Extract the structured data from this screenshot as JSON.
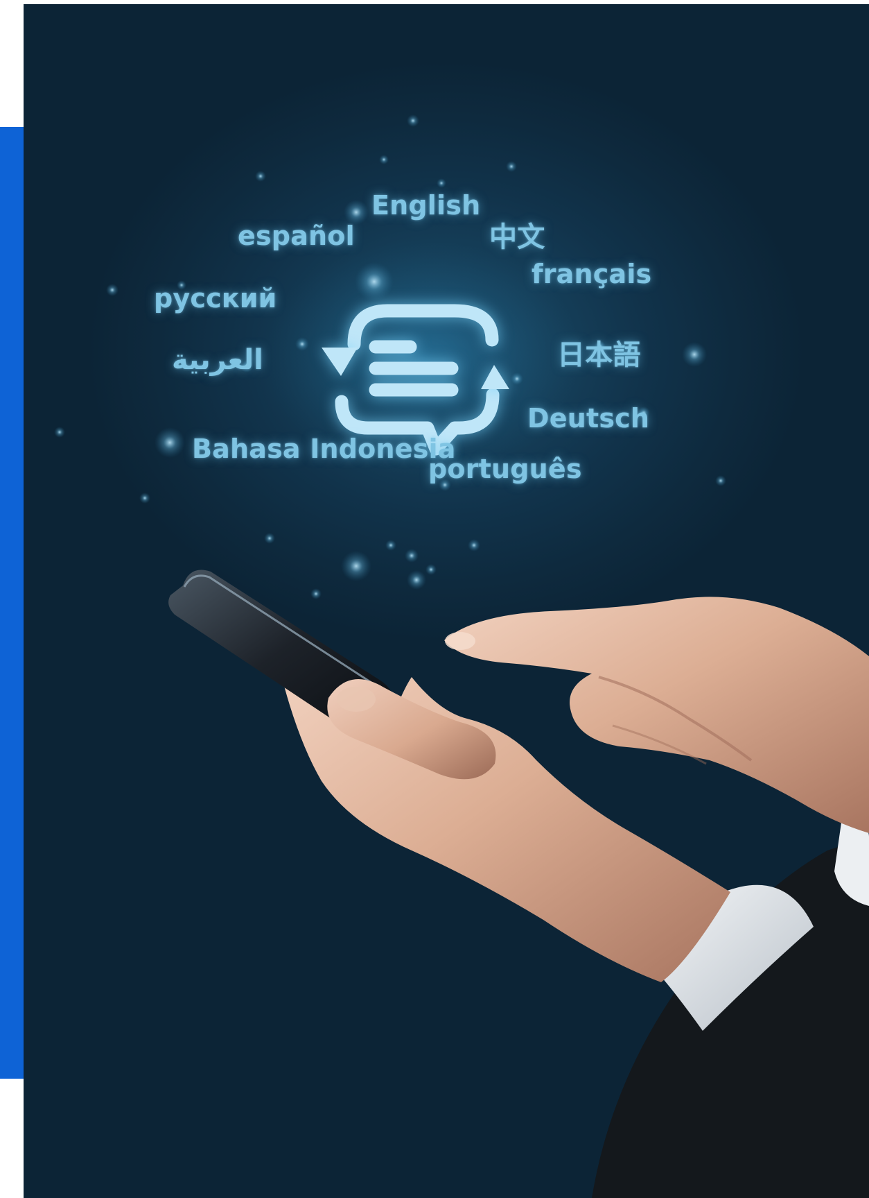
{
  "image": {
    "theme_colors": {
      "accent_bar": "#0e63d6",
      "background": "#0f2c41",
      "glow_text": "#7fc4e3"
    },
    "icon": "translate-chat-icon",
    "languages": [
      "English",
      "español",
      "中文",
      "français",
      "русский",
      "العربية",
      "日本語",
      "Deutsch",
      "Bahasa Indonesia",
      "português"
    ]
  }
}
